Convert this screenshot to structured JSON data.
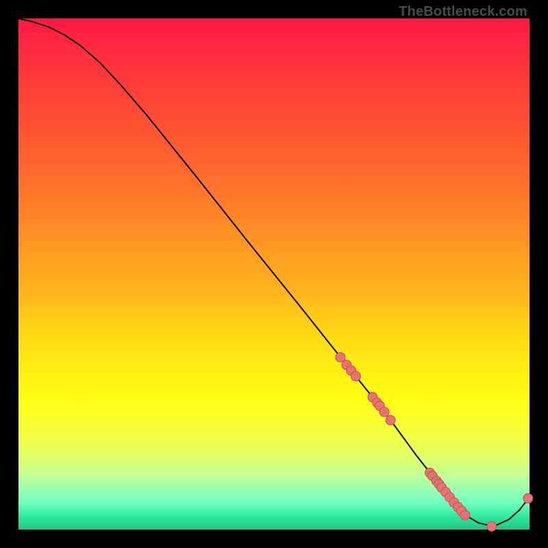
{
  "watermark": "TheBottleneck.com",
  "colors": {
    "line": "#000000",
    "point_fill": "#e57373",
    "point_stroke": "#c84e4e",
    "background": "#000000"
  },
  "chart_data": {
    "type": "line",
    "title": "",
    "xlabel": "",
    "ylabel": "",
    "xlim": [
      0,
      100
    ],
    "ylim": [
      0,
      100
    ],
    "x": [
      0,
      3,
      6,
      9,
      12,
      16,
      20,
      25,
      30,
      35,
      40,
      45,
      50,
      55,
      60,
      64,
      68,
      72,
      75,
      78,
      81,
      84,
      86,
      88,
      90,
      93,
      96,
      98,
      100
    ],
    "values": [
      100,
      99.3,
      98.3,
      96.8,
      94.8,
      91.3,
      87.0,
      81.2,
      75.0,
      68.8,
      62.5,
      56.2,
      50.0,
      43.8,
      37.5,
      32.5,
      27.5,
      22.5,
      18.4,
      14.3,
      10.5,
      6.8,
      4.4,
      2.5,
      1.3,
      0.6,
      2.0,
      3.8,
      6.3
    ],
    "points": [
      {
        "x": 63.0,
        "y": 33.7
      },
      {
        "x": 64.2,
        "y": 32.2
      },
      {
        "x": 65.1,
        "y": 31.1
      },
      {
        "x": 66.0,
        "y": 30.0
      },
      {
        "x": 69.3,
        "y": 25.9
      },
      {
        "x": 70.2,
        "y": 24.8
      },
      {
        "x": 70.7,
        "y": 24.2
      },
      {
        "x": 71.6,
        "y": 23.0
      },
      {
        "x": 72.8,
        "y": 21.4
      },
      {
        "x": 80.5,
        "y": 11.1
      },
      {
        "x": 81.0,
        "y": 10.5
      },
      {
        "x": 81.8,
        "y": 9.5
      },
      {
        "x": 82.3,
        "y": 8.9
      },
      {
        "x": 82.8,
        "y": 8.2
      },
      {
        "x": 83.6,
        "y": 7.3
      },
      {
        "x": 84.4,
        "y": 6.3
      },
      {
        "x": 85.2,
        "y": 5.3
      },
      {
        "x": 86.0,
        "y": 4.4
      },
      {
        "x": 86.7,
        "y": 3.6
      },
      {
        "x": 87.4,
        "y": 2.8
      },
      {
        "x": 92.6,
        "y": 0.6
      },
      {
        "x": 99.7,
        "y": 6.1
      }
    ]
  }
}
